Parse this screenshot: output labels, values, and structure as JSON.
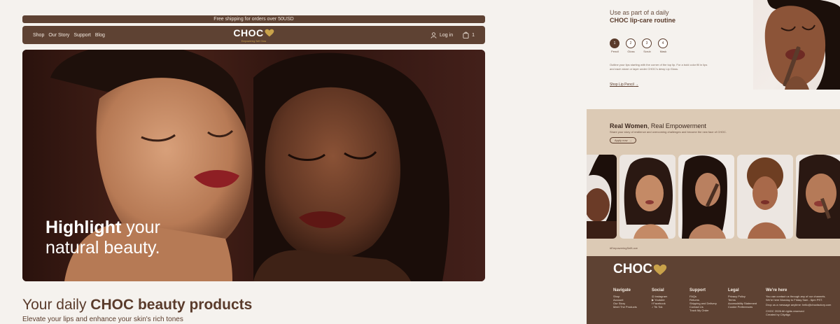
{
  "promo": {
    "text": "Free shipping for orders over 50USD"
  },
  "nav": {
    "links": [
      "Shop",
      "Our Story",
      "Support",
      "Blog"
    ],
    "brand": "CHOC",
    "tagline": "Empowering Self Glow",
    "login_label": "Log in",
    "cart_count": "1"
  },
  "hero": {
    "headline_bold": "Highlight",
    "headline_rest": " your",
    "headline_line2": "natural beauty."
  },
  "products": {
    "title_prefix": "Your daily ",
    "title_bold": "CHOC beauty products",
    "subtitle": "Elevate your lips and enhance your skin's rich tones"
  },
  "routine": {
    "intro": "Use as part of a daily",
    "title": "CHOC lip-care routine",
    "steps": [
      {
        "num": "1",
        "label": "Pencil"
      },
      {
        "num": "2",
        "label": "Gloss"
      },
      {
        "num": "3",
        "label": "Scrub"
      },
      {
        "num": "4",
        "label": "Mask"
      }
    ],
    "description": "Outline your lips starting with the corner of the top lip. For a bold color fill in lips and each stone or layer under CHOC's dewy Lip Gloss.",
    "shop_link": "Shop Lip Pencil"
  },
  "community": {
    "title_bold": "Real Women",
    "title_rest": ", Real Empowerment",
    "subtitle": "Share your story of resilience and overcoming challenges and become the new face of CHOC.",
    "apply_label": "Apply now",
    "hashtag": "#EmpoweringSelfLove"
  },
  "footer": {
    "brand": "CHOC",
    "navigate": {
      "heading": "Navigate",
      "items": [
        "Shop",
        "Account",
        "Our Story",
        "Meet The Products"
      ]
    },
    "social": {
      "heading": "Social",
      "items": [
        "Instagram",
        "Youtube",
        "Facebook",
        "Tik Tok"
      ]
    },
    "support": {
      "heading": "Support",
      "items": [
        "FAQs",
        "Returns",
        "Shipping and Delivery",
        "Contact Us",
        "Track My Order"
      ]
    },
    "legal": {
      "heading": "Legal",
      "items": [
        "Privacy Policy",
        "Terms",
        "Accessibility Statement",
        "Cookie Preferences"
      ]
    },
    "here": {
      "heading": "We're here",
      "lines": [
        "You can contact us through any of our channels.",
        "We're here Monday to Friday 9am - 6pm PST.",
        "Drop us a message anytime: hello@chocfactory.com"
      ],
      "copyright": "CHOC 2026 All rights reserved",
      "credit": "Created by Citydigo"
    }
  },
  "colors": {
    "brown": "#5e4233",
    "gold": "#c9a24a",
    "cream": "#f5f2ee",
    "sand": "#dccab5"
  }
}
